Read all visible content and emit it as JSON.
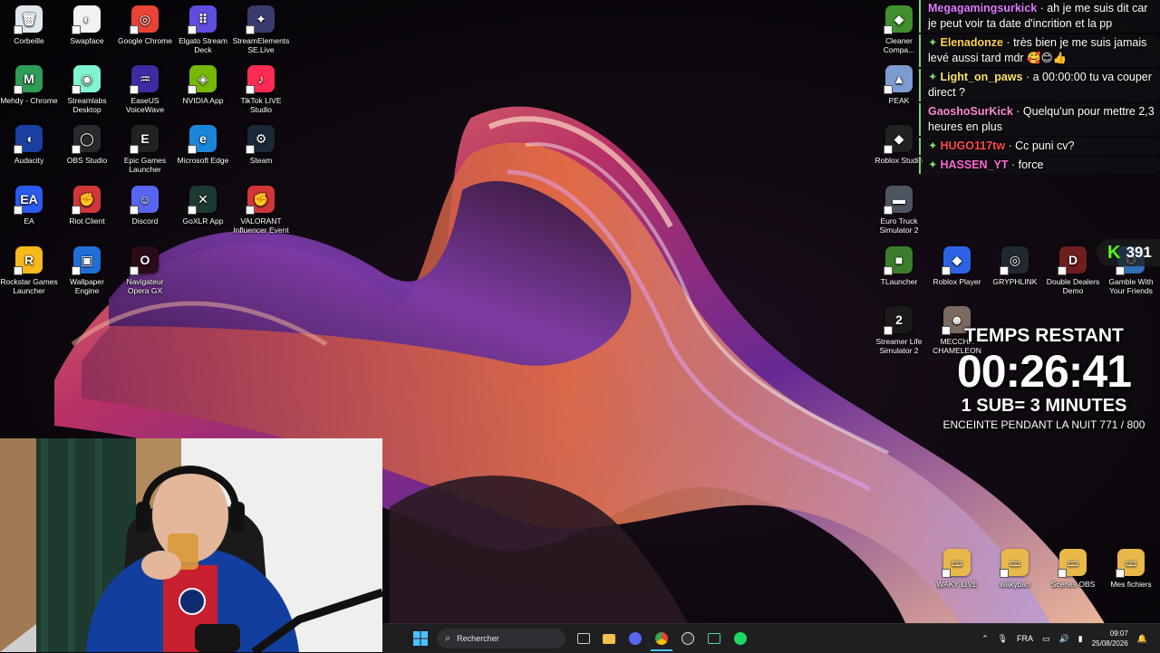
{
  "desktop": {
    "left_icons": [
      {
        "label": "Corbeille",
        "icon": "recycle-bin-icon",
        "color": "#dfe7ee",
        "glyph": "🗑"
      },
      {
        "label": "Swapface",
        "icon": "swapface-icon",
        "color": "#f2f2f2",
        "glyph": "◐"
      },
      {
        "label": "Google Chrome",
        "icon": "chrome-icon",
        "color": "#e94335",
        "glyph": "◎"
      },
      {
        "label": "Elgato Stream Deck",
        "icon": "stream-deck-icon",
        "color": "#5d4ee0",
        "glyph": "⠿"
      },
      {
        "label": "StreamElements SE.Live",
        "icon": "streamelements-icon",
        "color": "#3b3b6e",
        "glyph": "✦"
      },
      {
        "label": "Mehdy - Chrome",
        "icon": "chrome-profile-icon",
        "color": "#2e9d57",
        "glyph": "M"
      },
      {
        "label": "Streamlabs Desktop",
        "icon": "streamlabs-icon",
        "color": "#80f5d2",
        "glyph": "◉"
      },
      {
        "label": "EaseUS VoiceWave",
        "icon": "voicewave-icon",
        "color": "#3b2ca3",
        "glyph": "♒"
      },
      {
        "label": "NVIDIA App",
        "icon": "nvidia-icon",
        "color": "#76b900",
        "glyph": "◈"
      },
      {
        "label": "TikTok LIVE Studio",
        "icon": "tiktok-icon",
        "color": "#fe2c55",
        "glyph": "♪"
      },
      {
        "label": "Audacity",
        "icon": "audacity-icon",
        "color": "#1a3fa0",
        "glyph": "◖"
      },
      {
        "label": "OBS Studio",
        "icon": "obs-icon",
        "color": "#2a2a2e",
        "glyph": "◯"
      },
      {
        "label": "Epic Games Launcher",
        "icon": "epic-games-icon",
        "color": "#222222",
        "glyph": "E"
      },
      {
        "label": "Microsoft Edge",
        "icon": "edge-icon",
        "color": "#1b86d8",
        "glyph": "e"
      },
      {
        "label": "Steam",
        "icon": "steam-icon",
        "color": "#1b2838",
        "glyph": "⚙"
      },
      {
        "label": "EA",
        "icon": "ea-icon",
        "color": "#2b5bf0",
        "glyph": "EA"
      },
      {
        "label": "Riot Client",
        "icon": "riot-client-icon",
        "color": "#d13639",
        "glyph": "✊"
      },
      {
        "label": "Discord",
        "icon": "discord-icon",
        "color": "#5865f2",
        "glyph": "☺"
      },
      {
        "label": "GoXLR App",
        "icon": "goxlr-icon",
        "color": "#1c3a33",
        "glyph": "✕"
      },
      {
        "label": "VALORANT Influencer Event",
        "icon": "valorant-icon",
        "color": "#d13639",
        "glyph": "✊"
      },
      {
        "label": "Rockstar Games Launcher",
        "icon": "rockstar-icon",
        "color": "#f6b81a",
        "glyph": "R"
      },
      {
        "label": "Wallpaper Engine",
        "icon": "wallpaper-engine-icon",
        "color": "#1f6fd6",
        "glyph": "▣"
      },
      {
        "label": "Navigateur Opera GX",
        "icon": "opera-gx-icon",
        "color": "#2a0b18",
        "glyph": "O"
      }
    ],
    "right_icons": [
      {
        "label": "Cleaner Compa...",
        "icon": "cleaner-icon",
        "color": "#3f8f2e",
        "glyph": "◆"
      },
      {
        "label": "PEAK",
        "icon": "peak-icon",
        "color": "#7c9bd1",
        "glyph": "▲"
      },
      {
        "label": "Roblox Studio",
        "icon": "roblox-studio-icon",
        "color": "#222222",
        "glyph": "◆"
      },
      {
        "label": "Euro Truck Simulator 2",
        "icon": "ets2-icon",
        "color": "#4d5560",
        "glyph": "▬"
      },
      {
        "label": "TLauncher",
        "icon": "tlauncher-icon",
        "color": "#3b7d2c",
        "glyph": "■"
      },
      {
        "label": "Roblox Player",
        "icon": "roblox-player-icon",
        "color": "#2b63e6",
        "glyph": "◆"
      },
      {
        "label": "GRYPHLINK",
        "icon": "gryphlink-icon",
        "color": "#222831",
        "glyph": "◎"
      },
      {
        "label": "Double Dealers Demo",
        "icon": "double-dealers-icon",
        "color": "#6e1e1e",
        "glyph": "D"
      },
      {
        "label": "Gamble With Your Friends",
        "icon": "gamble-icon",
        "color": "#2f6db5",
        "glyph": "✪"
      },
      {
        "label": "Streamer Life Simulator 2",
        "icon": "streamer-life-icon",
        "color": "#1a1a1a",
        "glyph": "2"
      },
      {
        "label": "MECCHA CHAMELEON",
        "icon": "meccha-chameleon-icon",
        "color": "#7a6a60",
        "glyph": "☻"
      },
      {
        "label": "WAKY LIVE",
        "icon": "folder-icon",
        "color": "#e9b84a",
        "glyph": "▭"
      },
      {
        "label": "wakyban",
        "icon": "folder-icon",
        "color": "#e9b84a",
        "glyph": "▭"
      },
      {
        "label": "Scenes OBS",
        "icon": "folder-icon",
        "color": "#e9b84a",
        "glyph": "▭"
      },
      {
        "label": "Mes fichiers",
        "icon": "folder-icon",
        "color": "#e9b84a",
        "glyph": "▭"
      }
    ]
  },
  "chat": {
    "messages": [
      {
        "user": "Megagamingsurkick",
        "user_color": "#e07bff",
        "text": "ah je me suis dit car je peut voir ta date d'incrition et la pp",
        "badge": ""
      },
      {
        "user": "Elenadonze",
        "user_color": "#ffd24a",
        "text": "très bien je me suis jamais levé aussi tard mdr 🥰😊👍",
        "badge": "✦"
      },
      {
        "user": "Light_on_paws",
        "user_color": "#ffe66d",
        "text": "a 00:00:00 tu va couper direct ?",
        "badge": "✦"
      },
      {
        "user": "GaoshoSurKick",
        "user_color": "#ff8ad8",
        "text": "Quelqu'un pour mettre 2,3 heures en plus",
        "badge": ""
      },
      {
        "user": "HUGO117tw",
        "user_color": "#ff4a4a",
        "text": "Cc puni cv?",
        "badge": "✦"
      },
      {
        "user": "HASSEN_YT",
        "user_color": "#ff6ad5",
        "text": "force",
        "badge": "✦"
      }
    ]
  },
  "kick": {
    "count": "391",
    "logo": "K"
  },
  "timer": {
    "label": "TEMPS RESTANT",
    "time": "00:26:41",
    "rate": "1 SUB= 3 MINUTES",
    "goal": "ENCEINTE PENDANT LA NUIT 771 / 800"
  },
  "taskbar": {
    "search_placeholder": "Rechercher",
    "language": "FRA",
    "time": "09:07",
    "date": "25/08/2026",
    "colors": {
      "background": "#1f1f22",
      "accent": "#0078d4"
    }
  }
}
